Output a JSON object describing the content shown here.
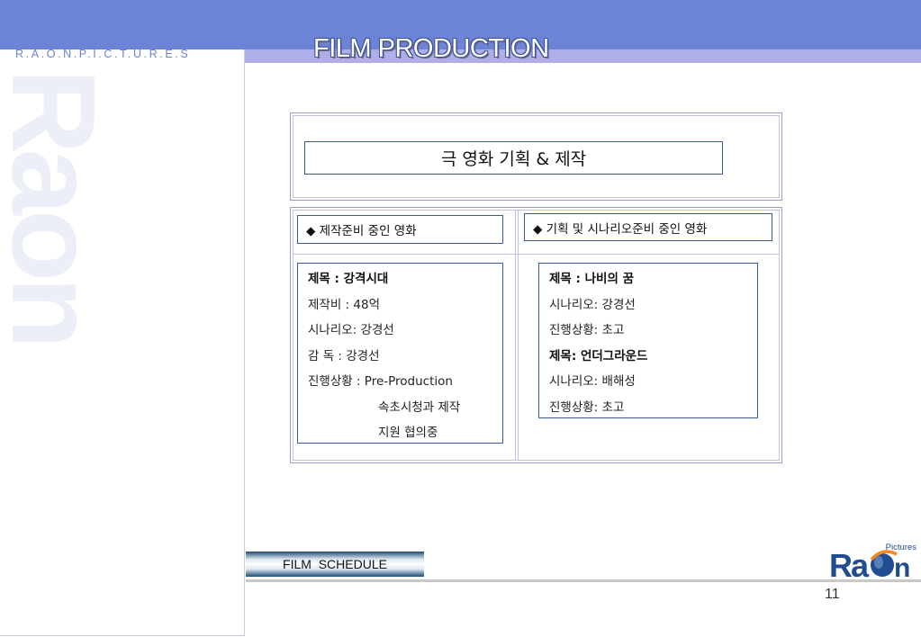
{
  "header": {
    "brand_text": "R.A.O.N.P.I.C.T.U.R.E.S",
    "title": "FILM PRODUCTION",
    "watermark_text": "Raon"
  },
  "main": {
    "heading": "극 영화 기획 & 제작",
    "left": {
      "header": "◆ 제작준비 중인 영화",
      "lines": [
        "제목 : 강격시대",
        "제작비 : 48억",
        "시나리오: 강경선",
        "감    독 : 강경선",
        "진행상황 : Pre-Production",
        "속초시청과 제작",
        "지원 협의중"
      ]
    },
    "right": {
      "header": "◆ 기획 및 시나리오준비 중인 영화",
      "lines": [
        "제목 : 나비의 꿈",
        "시나리오: 강경선",
        "진행상황: 초고",
        "제목: 언더그라운드",
        "시나리오: 배해성",
        "진행상황: 초고"
      ]
    }
  },
  "footer": {
    "schedule_label": "FILM  SCHEDULE",
    "page_number": "11",
    "logo_word_left": "Ra",
    "logo_word_right": "n",
    "logo_tag": "Pictures"
  },
  "colors": {
    "top_band": "#6b84d6",
    "sub_band": "#b0aee8",
    "box_border": "#3b5c98",
    "logo_blue": "#1f4d8f",
    "logo_orange": "#f28a1e"
  }
}
